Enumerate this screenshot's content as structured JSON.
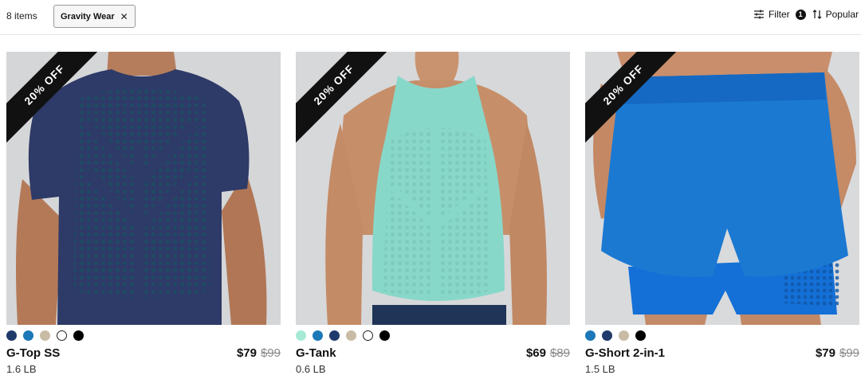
{
  "toolbar": {
    "item_count": "8 items",
    "active_filter": "Gravity Wear",
    "filter_label": "Filter",
    "filter_count": "1",
    "sort_label": "Popular"
  },
  "products": [
    {
      "name": "G-Top SS",
      "price": "$79",
      "original_price": "$99",
      "weight": "1.6 LB",
      "badge": "20% OFF",
      "swatches": [
        "#1f3a6b",
        "#1c78b8",
        "#c9bca6",
        "#ffffff",
        "#000000"
      ]
    },
    {
      "name": "G-Tank",
      "price": "$69",
      "original_price": "$89",
      "weight": "0.6 LB",
      "badge": "20% OFF",
      "swatches": [
        "#a6ead6",
        "#1c78b8",
        "#1f3a6b",
        "#c9bca6",
        "#ffffff",
        "#000000"
      ]
    },
    {
      "name": "G-Short 2-in-1",
      "price": "$79",
      "original_price": "$99",
      "weight": "1.5 LB",
      "badge": "20% OFF",
      "swatches": [
        "#1c78b8",
        "#1f3a6b",
        "#c9bca6",
        "#000000"
      ]
    }
  ]
}
